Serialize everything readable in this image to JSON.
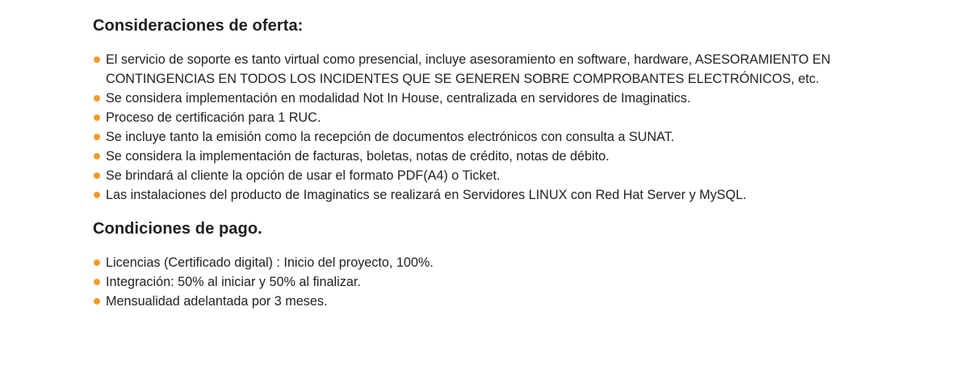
{
  "sections": [
    {
      "title": "Consideraciones de oferta:",
      "items": [
        "El servicio de soporte es tanto virtual como presencial, incluye asesoramiento en software, hardware, ASESORAMIENTO EN CONTINGENCIAS EN TODOS LOS INCIDENTES QUE SE GENEREN SOBRE COMPROBANTES ELECTRÓNICOS, etc.",
        "Se considera implementación en modalidad Not In House, centralizada en servidores de Imaginatics.",
        "Proceso de certificación para 1 RUC.",
        "Se incluye tanto la emisión como la recepción de documentos electrónicos con consulta a SUNAT.",
        "Se considera la implementación de facturas, boletas, notas de crédito, notas de débito.",
        "Se brindará al cliente la opción de usar el formato PDF(A4) o Ticket.",
        "Las instalaciones del producto de Imaginatics se realizará en Servidores LINUX con Red Hat Server y MySQL."
      ]
    },
    {
      "title": "Condiciones de pago.",
      "items": [
        "Licencias (Certificado digital) : Inicio del proyecto, 100%.",
        "Integración: 50% al iniciar y 50% al finalizar.",
        "Mensualidad adelantada por 3 meses."
      ]
    }
  ],
  "colors": {
    "bullet": "#f39a2b",
    "text": "#222222"
  }
}
